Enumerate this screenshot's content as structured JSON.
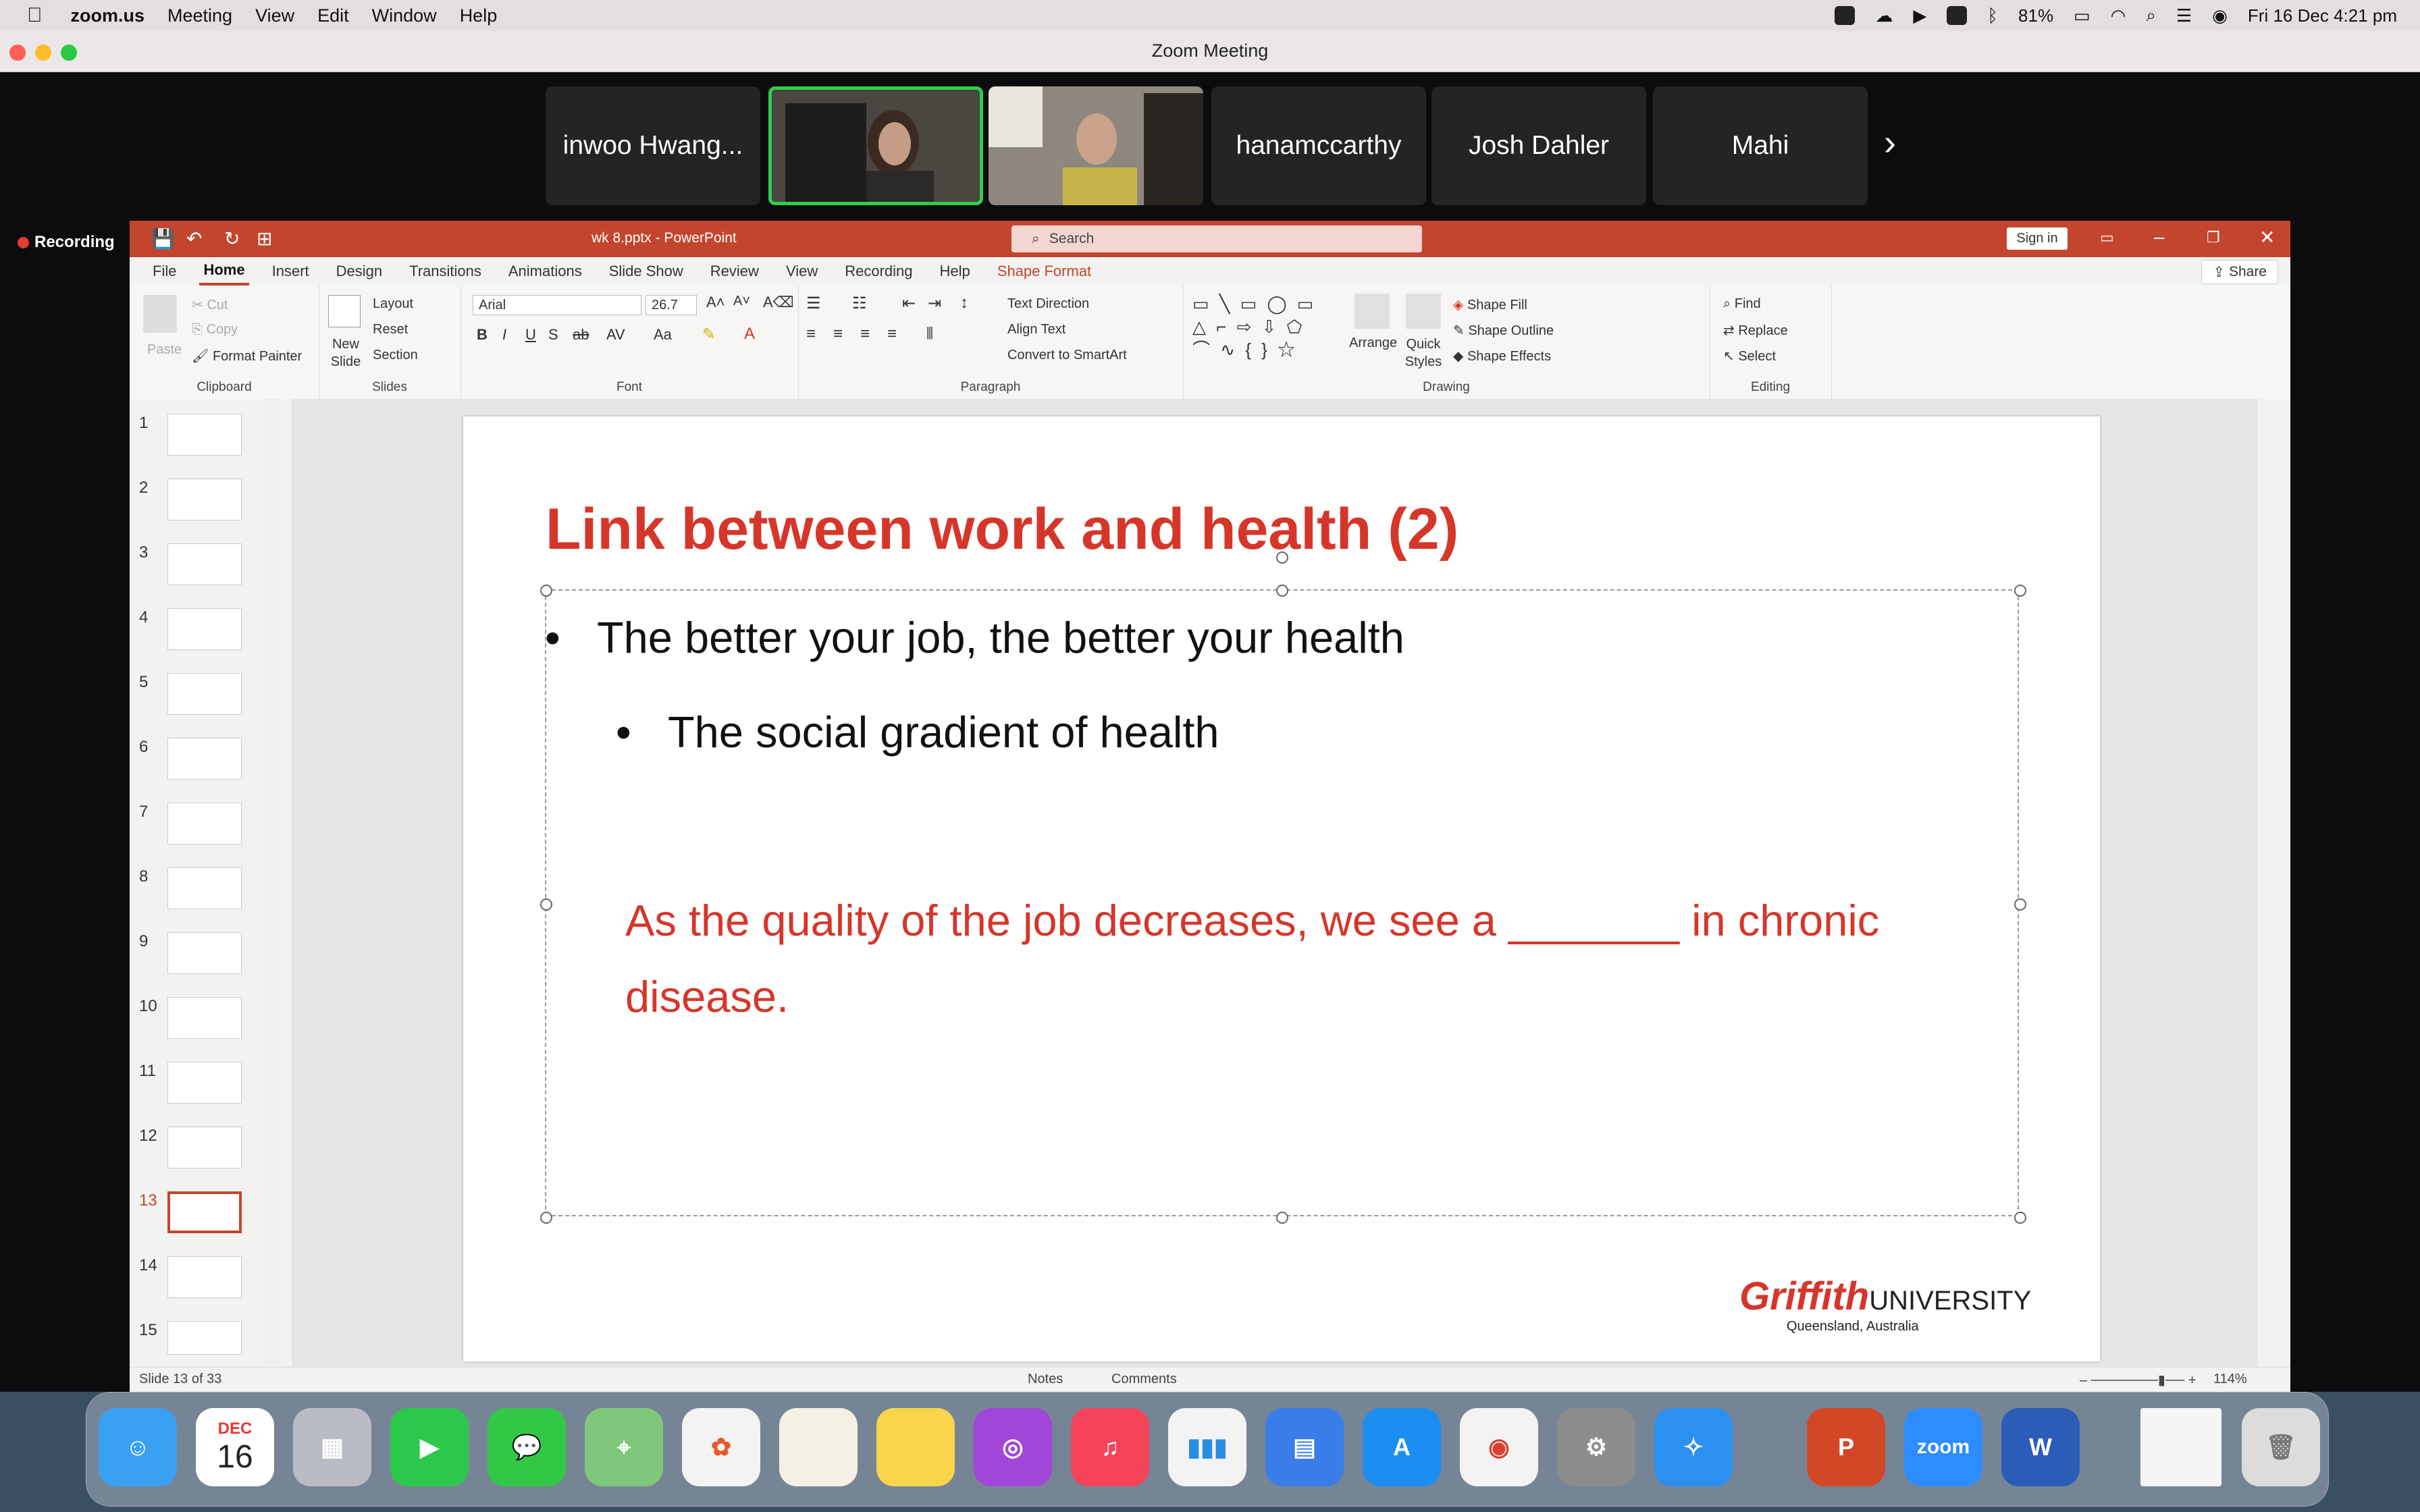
{
  "menubar": {
    "apple": "",
    "app": "zoom.us",
    "items": [
      "Meeting",
      "View",
      "Edit",
      "Window",
      "Help"
    ],
    "battery": "81%",
    "datetime": "Fri 16 Dec  4:21 pm"
  },
  "zoom": {
    "window_title": "Zoom Meeting",
    "recording": "Recording",
    "participants": [
      "inwoo Hwang...",
      "",
      "",
      "hanamccarthy",
      "Josh Dahler",
      "Mahi"
    ],
    "next": "›"
  },
  "ppt": {
    "doc_title": "wk 8.pptx  -  PowerPoint",
    "search_placeholder": "Search",
    "sign_in": "Sign in",
    "tabs": [
      "File",
      "Home",
      "Insert",
      "Design",
      "Transitions",
      "Animations",
      "Slide Show",
      "Review",
      "View",
      "Recording",
      "Help",
      "Shape Format"
    ],
    "share": "Share",
    "ribbon": {
      "clipboard": {
        "label": "Clipboard",
        "paste": "Paste",
        "cut": "Cut",
        "copy": "Copy",
        "format_painter": "Format Painter"
      },
      "slides": {
        "label": "Slides",
        "new_slide": "New Slide",
        "layout": "Layout",
        "reset": "Reset",
        "section": "Section"
      },
      "font": {
        "label": "Font",
        "family": "Arial",
        "size": "26.7"
      },
      "paragraph": {
        "label": "Paragraph",
        "text_direction": "Text Direction",
        "align_text": "Align Text",
        "convert": "Convert to SmartArt"
      },
      "drawing": {
        "label": "Drawing",
        "arrange": "Arrange",
        "quick_styles": "Quick Styles",
        "shape_fill": "Shape Fill",
        "shape_outline": "Shape Outline",
        "shape_effects": "Shape Effects"
      },
      "editing": {
        "label": "Editing",
        "find": "Find",
        "replace": "Replace",
        "select": "Select"
      }
    },
    "thumbs": [
      "1",
      "2",
      "3",
      "4",
      "5",
      "6",
      "7",
      "8",
      "9",
      "10",
      "11",
      "12",
      "13",
      "14",
      "15"
    ],
    "selected_slide": 13,
    "slide": {
      "title": "Link between work and health (2)",
      "bullet1": "The better your job, the better your health",
      "bullet2": "The social gradient of health",
      "para": "As the quality of the job decreases, we see a _______ in chronic disease.",
      "logo": "Griffith",
      "logo_u": "UNIVERSITY",
      "logo_sub": "Queensland, Australia"
    },
    "status": {
      "slide": "Slide 13 of 33",
      "notes": "Notes",
      "comments": "Comments",
      "zoom": "114%"
    }
  },
  "dock": {
    "calendar_month": "DEC",
    "calendar_day": "16",
    "zoom_label": "zoom"
  },
  "colors": {
    "ppt_red": "#c4452e",
    "accent_red": "#d6362a",
    "active_green": "#2fcf4d"
  }
}
